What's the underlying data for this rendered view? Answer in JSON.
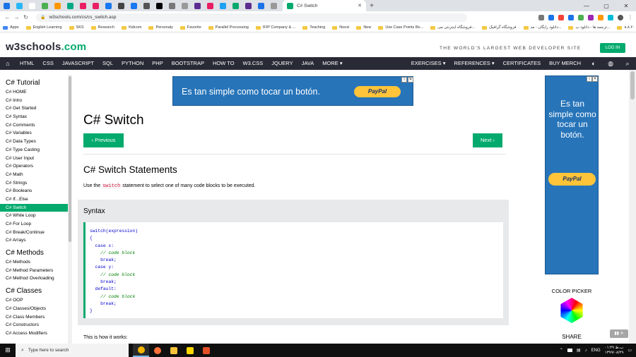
{
  "browser": {
    "active_tab": "C# Switch",
    "url": "w3schools.com/cs/cs_switch.asp",
    "mini_tab_colors": [
      "#1a73e8",
      "#29b6f6",
      "#ffffff",
      "#4caf50",
      "#ff9800",
      "#00a884",
      "#e91e63",
      "#e91e63",
      "#1877f2",
      "#444444",
      "#1877f2",
      "#555555",
      "#000000",
      "#777777",
      "#999999",
      "#5c2d91",
      "#e91e63",
      "#1da1f2",
      "#04aa6d",
      "#5c2d91",
      "#1a73e8",
      "#999999"
    ],
    "bookmarks": [
      "Apps",
      "English Learning",
      "SKS",
      "Research",
      "Kidcom",
      "Personaly",
      "Favorite",
      "Parallel Processing",
      "IFIP Company & ...",
      "Teaching",
      "Noozi",
      "New",
      "Use Case Points Be...",
      "فروشگاه اینترنتی می...",
      "فروشگاه گرافیک",
      "دانلود رایگان - مد...",
      "ترجمه ها - دانلود ب...",
      "لایحه گزارش ۸.۸.۲۰"
    ]
  },
  "header": {
    "logo_main": "w3schools",
    "logo_dot": ".com",
    "tagline": "THE WORLD'S LARGEST WEB DEVELOPER SITE",
    "login": "LOG IN"
  },
  "nav": {
    "items": [
      "HTML",
      "CSS",
      "JAVASCRIPT",
      "SQL",
      "PYTHON",
      "PHP",
      "BOOTSTRAP",
      "HOW TO",
      "W3.CSS",
      "JQUERY",
      "JAVA",
      "MORE ▾"
    ],
    "right_items": [
      "EXERCISES ▾",
      "REFERENCES ▾",
      "CERTIFICATES",
      "BUY MERCH"
    ]
  },
  "sidebar": {
    "sections": [
      {
        "title": "C# Tutorial",
        "items": [
          "C# HOME",
          "C# Intro",
          "C# Get Started",
          "C# Syntax",
          "C# Comments",
          "C# Variables",
          "C# Data Types",
          "C# Type Casting",
          "C# User Input",
          "C# Operators",
          "C# Math",
          "C# Strings",
          "C# Booleans",
          "C# If...Else",
          "C# Switch",
          "C# While Loop",
          "C# For Loop",
          "C# Break/Continue",
          "C# Arrays"
        ]
      },
      {
        "title": "C# Methods",
        "items": [
          "C# Methods",
          "C# Method Parameters",
          "C# Method Overloading"
        ]
      },
      {
        "title": "C# Classes",
        "items": [
          "C# OOP",
          "C# Classes/Objects",
          "C# Class Members",
          "C# Constructors",
          "C# Access Modifiers"
        ]
      }
    ],
    "active_item": "C# Switch"
  },
  "ads": {
    "top_text": "Es tan simple como tocar un botón.",
    "side_text": "Es tan simple como tocar un botón.",
    "paypal": "PayPal"
  },
  "content": {
    "title": "C# Switch",
    "prev": "‹ Previous",
    "next": "Next ›",
    "section_title": "C# Switch Statements",
    "intro_pre": "Use the ",
    "intro_kw": "switch",
    "intro_post": " statement to select one of many code blocks to be executed.",
    "syntax_title": "Syntax",
    "code": [
      {
        "text": "switch(expression)",
        "comment": false
      },
      {
        "text": "{",
        "comment": false
      },
      {
        "text": "  case x:",
        "comment": false
      },
      {
        "text": "    // code block",
        "comment": true
      },
      {
        "text": "    break;",
        "comment": false
      },
      {
        "text": "  case y:",
        "comment": false
      },
      {
        "text": "    // code block",
        "comment": true
      },
      {
        "text": "    break;",
        "comment": false
      },
      {
        "text": "  default:",
        "comment": false
      },
      {
        "text": "    // code block",
        "comment": true
      },
      {
        "text": "    break;",
        "comment": false
      },
      {
        "text": "}",
        "comment": false
      }
    ],
    "how_it_works": "This is how it works:"
  },
  "right_col": {
    "color_picker": "COLOR PICKER",
    "share": "SHARE"
  },
  "taskbar": {
    "search": "Type here to search",
    "apps": [
      {
        "name": "chrome",
        "color": "#f4b400"
      },
      {
        "name": "firefox",
        "color": "#ff7139"
      },
      {
        "name": "explorer",
        "color": "#f8c33a"
      },
      {
        "name": "notes",
        "color": "#ffd800"
      },
      {
        "name": "html5",
        "color": "#e34f26"
      }
    ],
    "lang": "ENG",
    "time": "۰۱:۴۹ ب.ظ",
    "date": "۱۳۹۹/۰۸/۲۹"
  }
}
